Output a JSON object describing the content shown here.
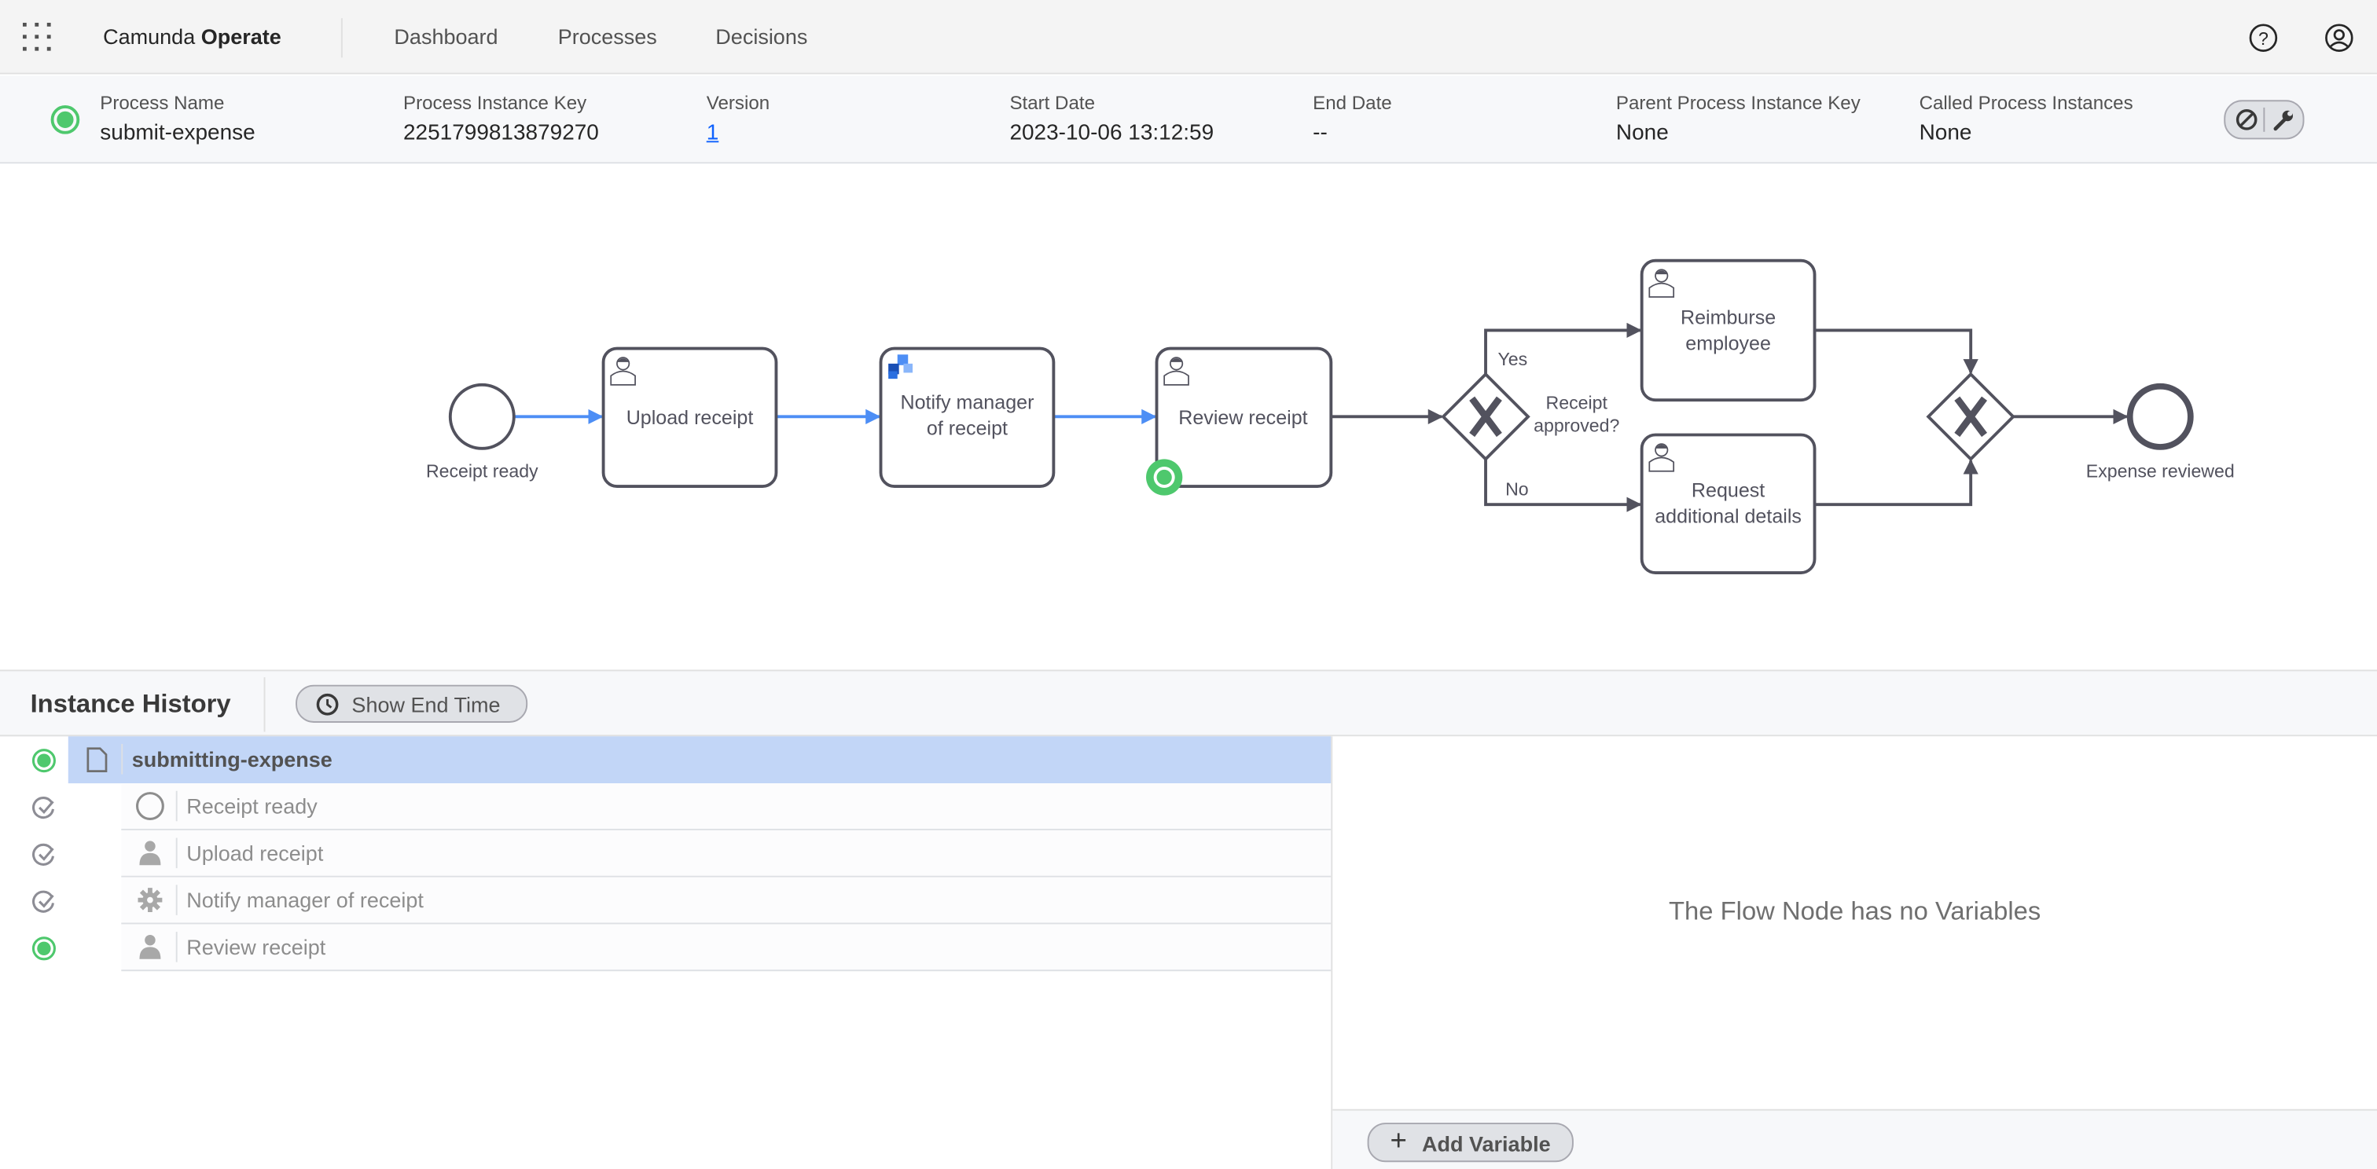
{
  "header": {
    "brand_prefix": "Camunda",
    "brand_product": "Operate",
    "nav": [
      "Dashboard",
      "Processes",
      "Decisions"
    ],
    "icons": [
      "apps-grid-icon",
      "help-icon",
      "user-icon"
    ]
  },
  "instance": {
    "status_color": "#4ec86d",
    "fields": [
      {
        "label": "Process Name",
        "value": "submit-expense"
      },
      {
        "label": "Process Instance Key",
        "value": "2251799813879270"
      },
      {
        "label": "Version",
        "value": "1"
      },
      {
        "label": "Start Date",
        "value": "2023-10-06 13:12:59"
      },
      {
        "label": "End Date",
        "value": "--"
      },
      {
        "label": "Parent Process Instance Key",
        "value": "None"
      },
      {
        "label": "Called Process Instances",
        "value": "None"
      }
    ],
    "actions": [
      "cancel-icon",
      "modify-wrench-icon"
    ]
  },
  "diagram": {
    "start_event": "Receipt ready",
    "tasks": {
      "upload": "Upload receipt",
      "notify": "Notify manager of receipt",
      "review": "Review receipt",
      "reimburse": "Reimburse employee",
      "request": "Request additional details"
    },
    "notify_lines": [
      "Notify manager",
      "of receipt"
    ],
    "reimburse_lines": [
      "Reimburse",
      "employee"
    ],
    "request_lines": [
      "Request",
      "additional details"
    ],
    "gateway_lines": [
      "Receipt",
      "approved?"
    ],
    "flow_yes": "Yes",
    "flow_no": "No",
    "end_event": "Expense reviewed",
    "active_color": "#4ec86d",
    "completed_flow_color": "#4d8ef5"
  },
  "history": {
    "title": "Instance History",
    "show_end_time": "Show End Time",
    "root": {
      "label": "submitting-expense",
      "state": "active"
    },
    "items": [
      {
        "label": "Receipt ready",
        "state": "completed",
        "icon": "start-event-icon"
      },
      {
        "label": "Upload receipt",
        "state": "completed",
        "icon": "user-task-icon"
      },
      {
        "label": "Notify manager of receipt",
        "state": "completed",
        "icon": "service-task-gear-icon"
      },
      {
        "label": "Review receipt",
        "state": "active",
        "icon": "user-task-icon"
      }
    ]
  },
  "variables": {
    "empty_message": "The Flow Node has no Variables",
    "add_label": "Add Variable"
  }
}
